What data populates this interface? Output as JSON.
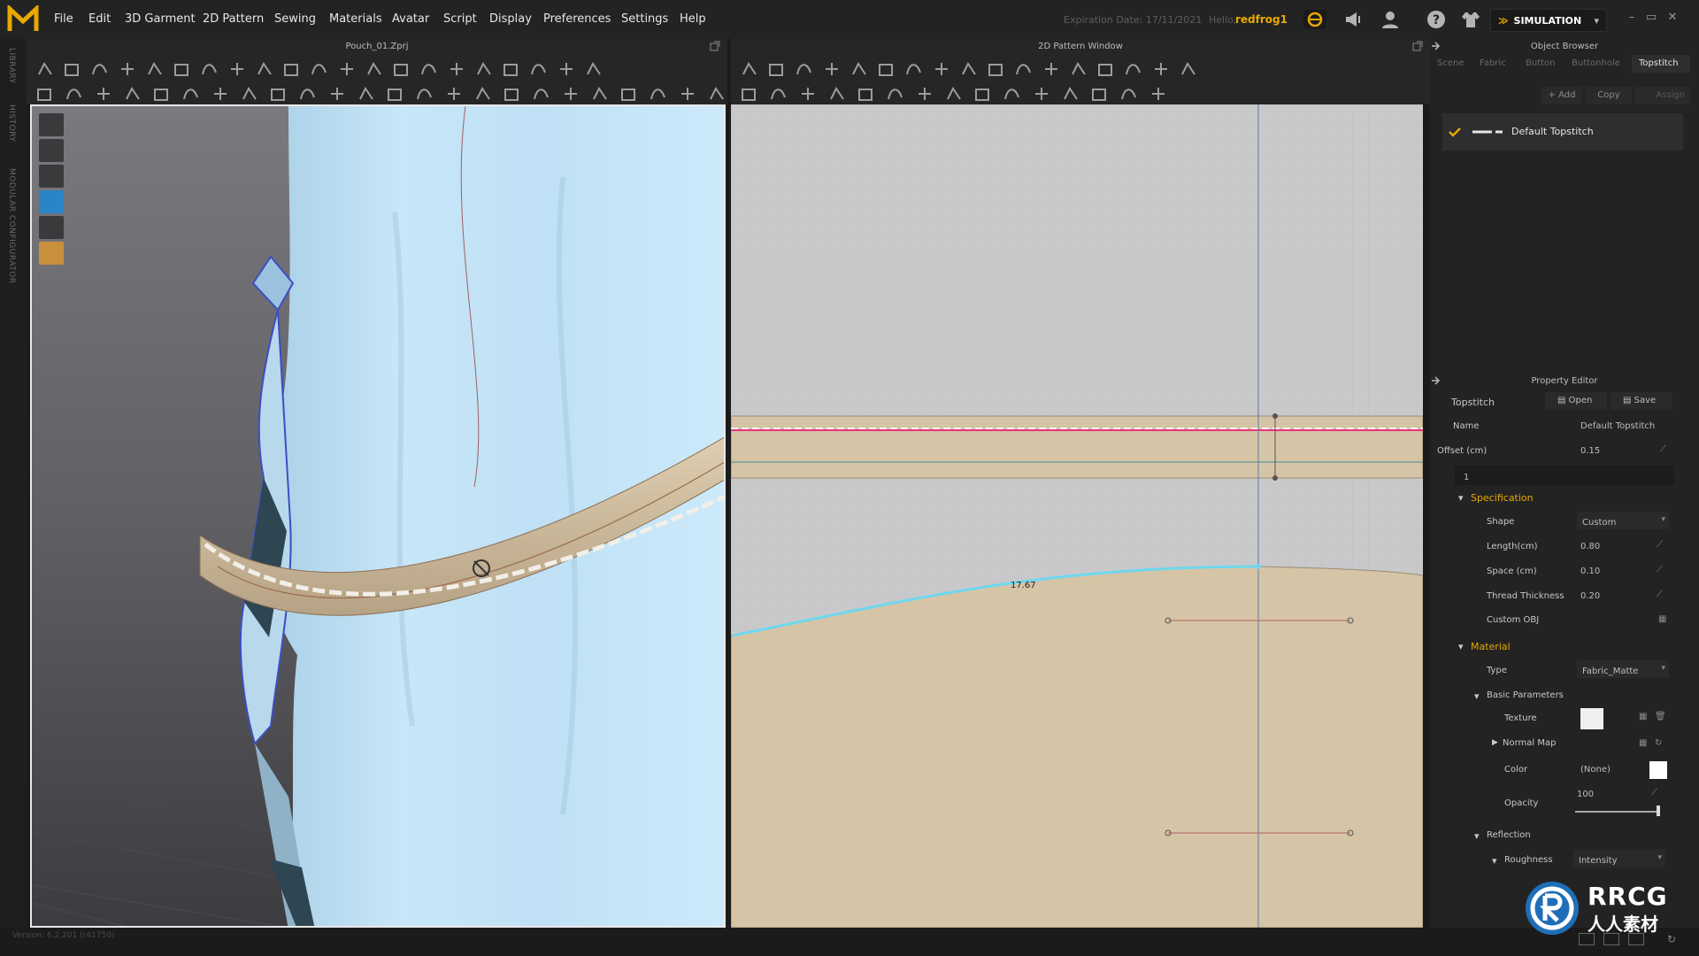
{
  "app": {
    "menu": [
      "File",
      "Edit",
      "3D Garment",
      "2D Pattern",
      "Sewing",
      "Materials",
      "Avatar",
      "Script",
      "Display",
      "Preferences",
      "Settings",
      "Help"
    ],
    "expiration": "Expiration Date: 17/11/2021",
    "hello": "Hello,",
    "user": "redfrog1",
    "mode": "SIMULATION",
    "window_controls": [
      "–",
      "▭",
      "✕"
    ]
  },
  "left_strip": {
    "labels": [
      "LIBRARY",
      "HISTORY",
      "MODULAR CONFIGURATOR"
    ]
  },
  "view3d": {
    "title": "Pouch_01.Zprj"
  },
  "view2d": {
    "title": "2D Pattern Window",
    "measurement": "17.67"
  },
  "object_browser": {
    "title": "Object Browser",
    "tabs": [
      "Scene",
      "Fabric",
      "Button",
      "Buttonhole",
      "Topstitch"
    ],
    "active_tab": "Topstitch",
    "add_label": "+ Add",
    "copy_label": "Copy",
    "assign_label": "Assign",
    "item": "Default Topstitch"
  },
  "property_editor": {
    "title": "Property Editor",
    "kind": "Topstitch",
    "open_label": "Open",
    "save_label": "Save",
    "name_label": "Name",
    "name_value": "Default Topstitch",
    "offset_label": "Offset (cm)",
    "offset_value": "0.15",
    "offset_count": "1",
    "specification": {
      "title": "Specification",
      "shape_label": "Shape",
      "shape_value": "Custom",
      "length_label": "Length(cm)",
      "length_value": "0.80",
      "space_label": "Space (cm)",
      "space_value": "0.10",
      "thread_label": "Thread Thickness",
      "thread_value": "0.20",
      "obj_label": "Custom OBJ"
    },
    "material": {
      "title": "Material",
      "type_label": "Type",
      "type_value": "Fabric_Matte",
      "basic_title": "Basic Parameters",
      "texture_label": "Texture",
      "normal_label": "Normal Map",
      "color_label": "Color",
      "color_value": "(None)",
      "opacity_label": "Opacity",
      "opacity_value": "100",
      "opacity_fraction": 1.0,
      "reflection_title": "Reflection",
      "roughness_label": "Roughness",
      "roughness_value": "Intensity"
    }
  },
  "statusbar": {
    "version": "Version: 6.2.201 (r41750)"
  },
  "watermark": {
    "brand": "RRCG",
    "sub": "人人素材"
  },
  "colors": {
    "accent": "#e8a800",
    "cyan_line": "#6ed8ee",
    "pink_line": "#e8337a",
    "fabric": "#d6c4a6",
    "shirt": "#bfe0f5"
  }
}
